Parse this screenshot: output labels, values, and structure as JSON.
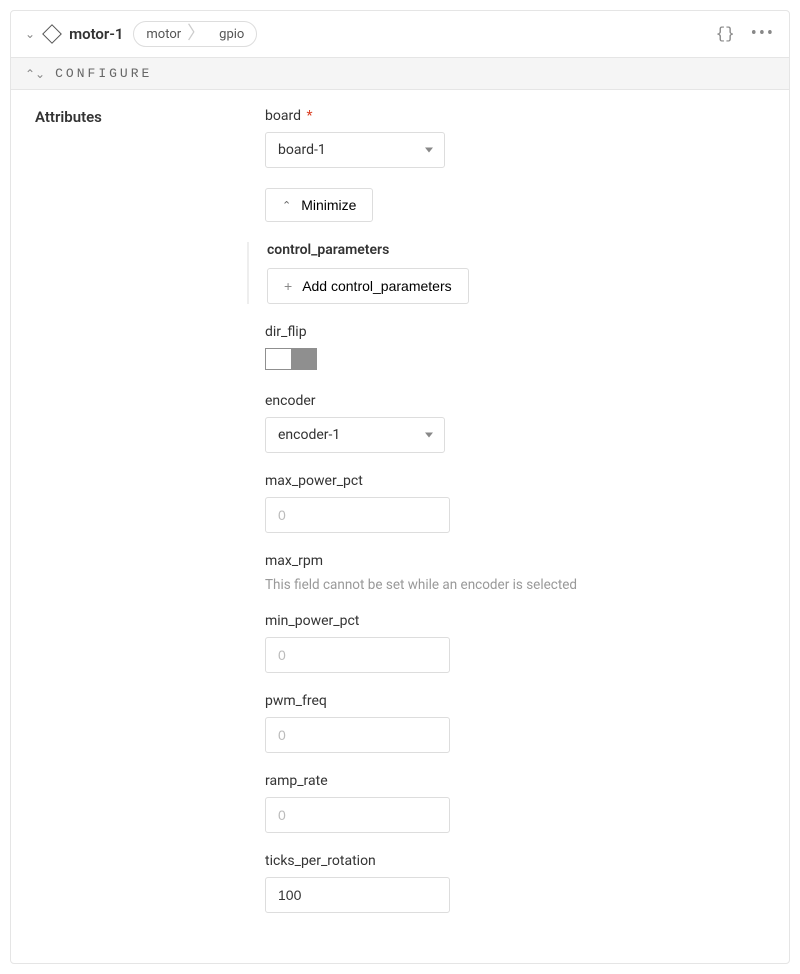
{
  "header": {
    "title": "motor-1",
    "breadcrumb": [
      "motor",
      "gpio"
    ]
  },
  "configure": {
    "label": "CONFIGURE"
  },
  "section": {
    "title": "Attributes"
  },
  "fields": {
    "board": {
      "label": "board",
      "required": "*",
      "value": "board-1"
    },
    "minimize": {
      "label": "Minimize"
    },
    "control_parameters": {
      "label": "control_parameters",
      "add_label": "Add control_parameters"
    },
    "dir_flip": {
      "label": "dir_flip",
      "value": false
    },
    "encoder": {
      "label": "encoder",
      "value": "encoder-1"
    },
    "max_power_pct": {
      "label": "max_power_pct",
      "placeholder": "0"
    },
    "max_rpm": {
      "label": "max_rpm",
      "note": "This field cannot be set while an encoder is selected"
    },
    "min_power_pct": {
      "label": "min_power_pct",
      "placeholder": "0"
    },
    "pwm_freq": {
      "label": "pwm_freq",
      "placeholder": "0"
    },
    "ramp_rate": {
      "label": "ramp_rate",
      "placeholder": "0"
    },
    "ticks_per_rotation": {
      "label": "ticks_per_rotation",
      "value": "100"
    }
  }
}
